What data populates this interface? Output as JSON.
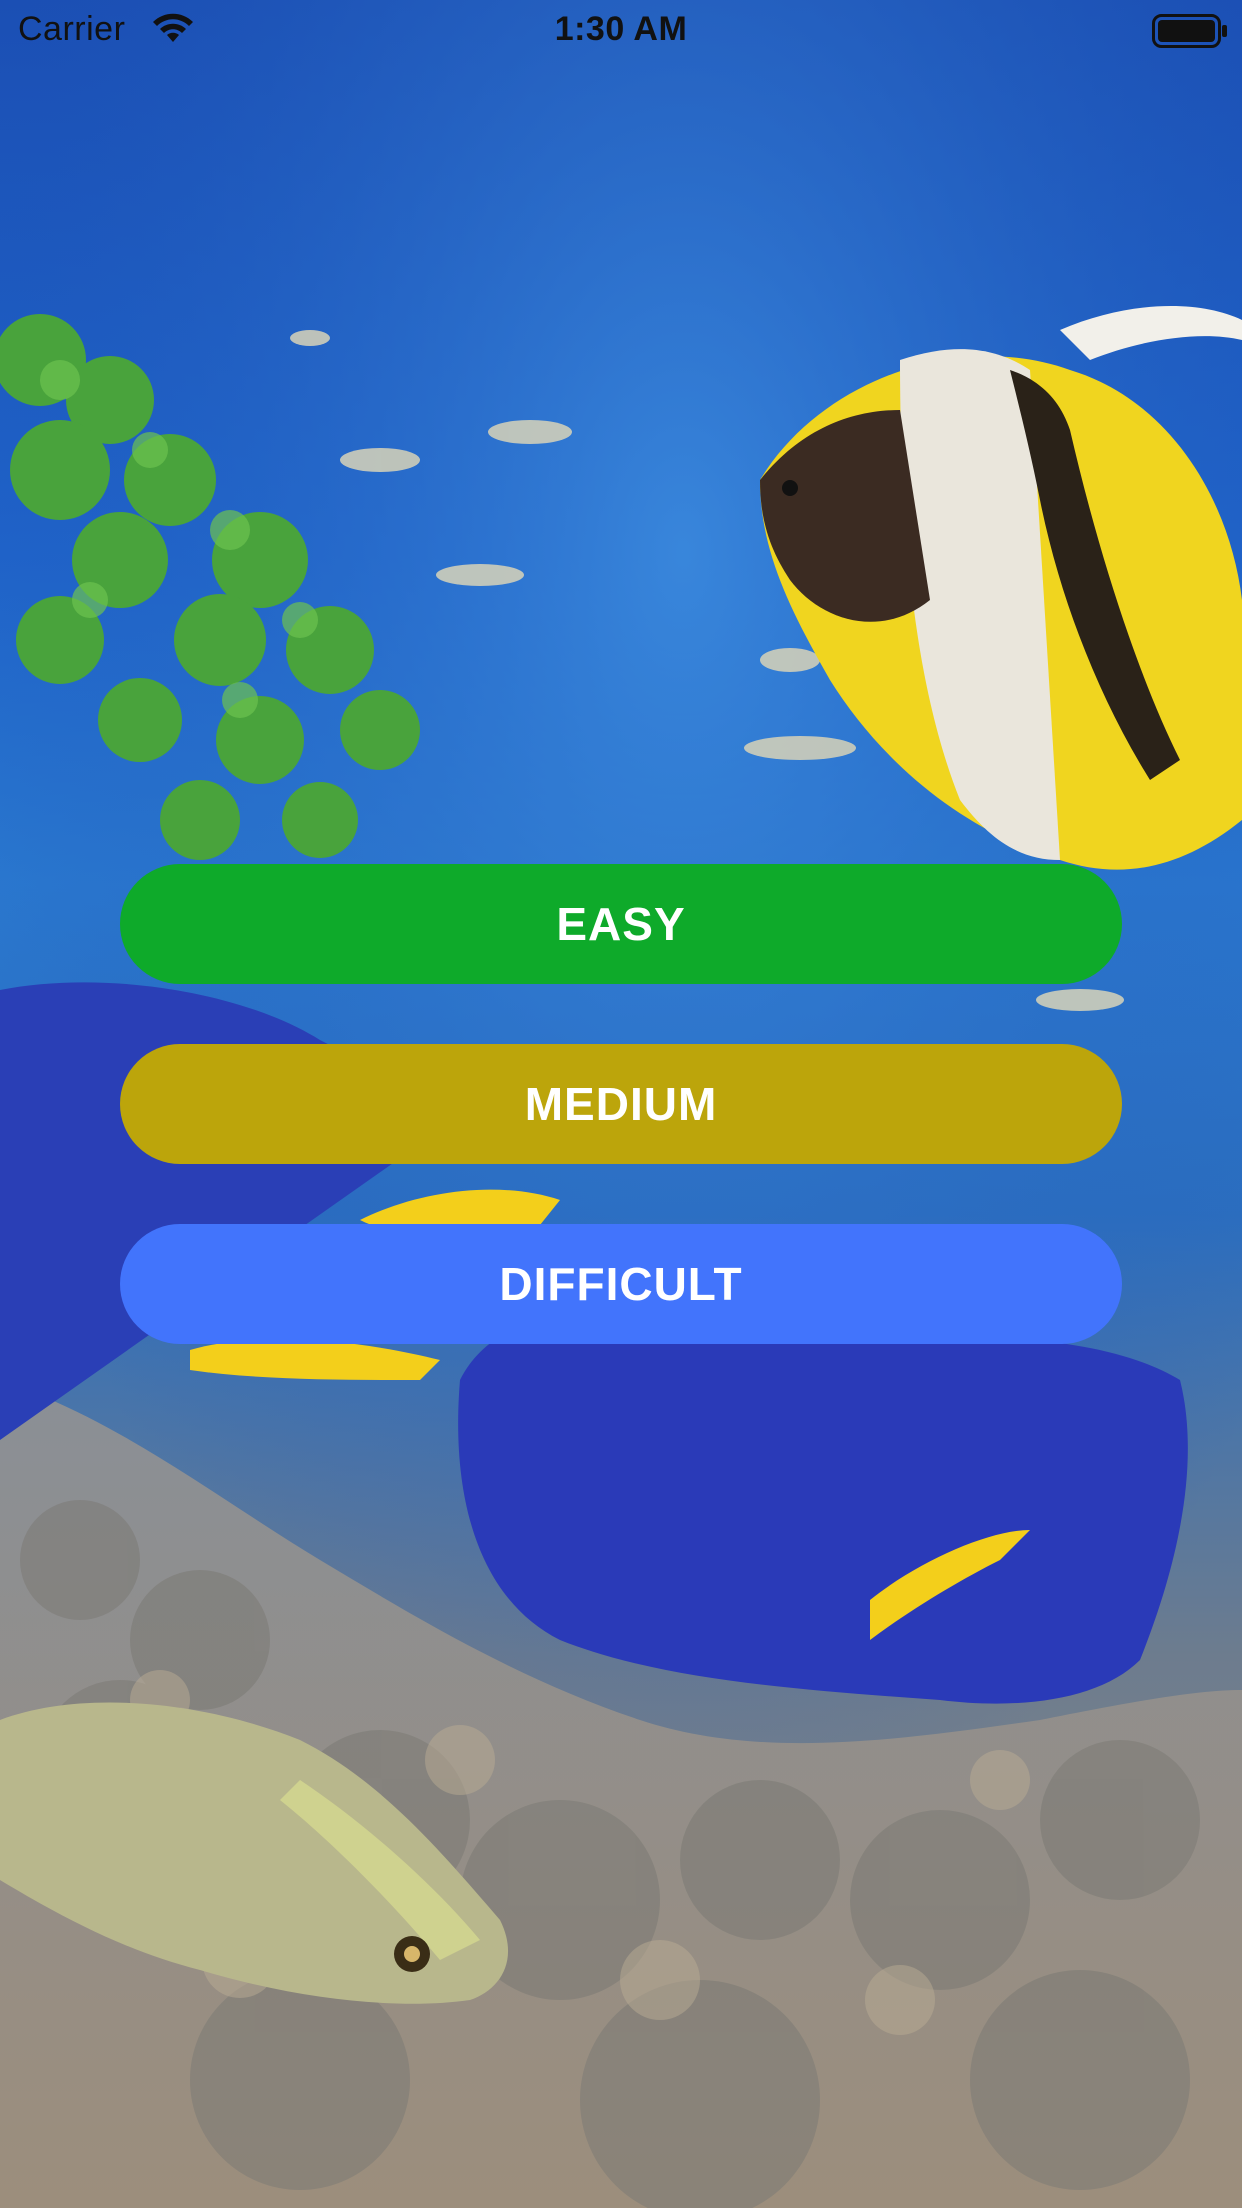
{
  "status_bar": {
    "carrier": "Carrier",
    "time": "1:30 AM",
    "wifi_icon": "wifi-icon",
    "battery_icon": "battery-icon"
  },
  "background": {
    "icon": "underwater-coral-reef-photo"
  },
  "difficulty": {
    "easy_label": "EASY",
    "medium_label": "MEDIUM",
    "difficult_label": "DIFFICULT"
  },
  "colors": {
    "easy": "#0eaa2a",
    "medium": "#bca50b",
    "difficult": "#4274fc"
  }
}
